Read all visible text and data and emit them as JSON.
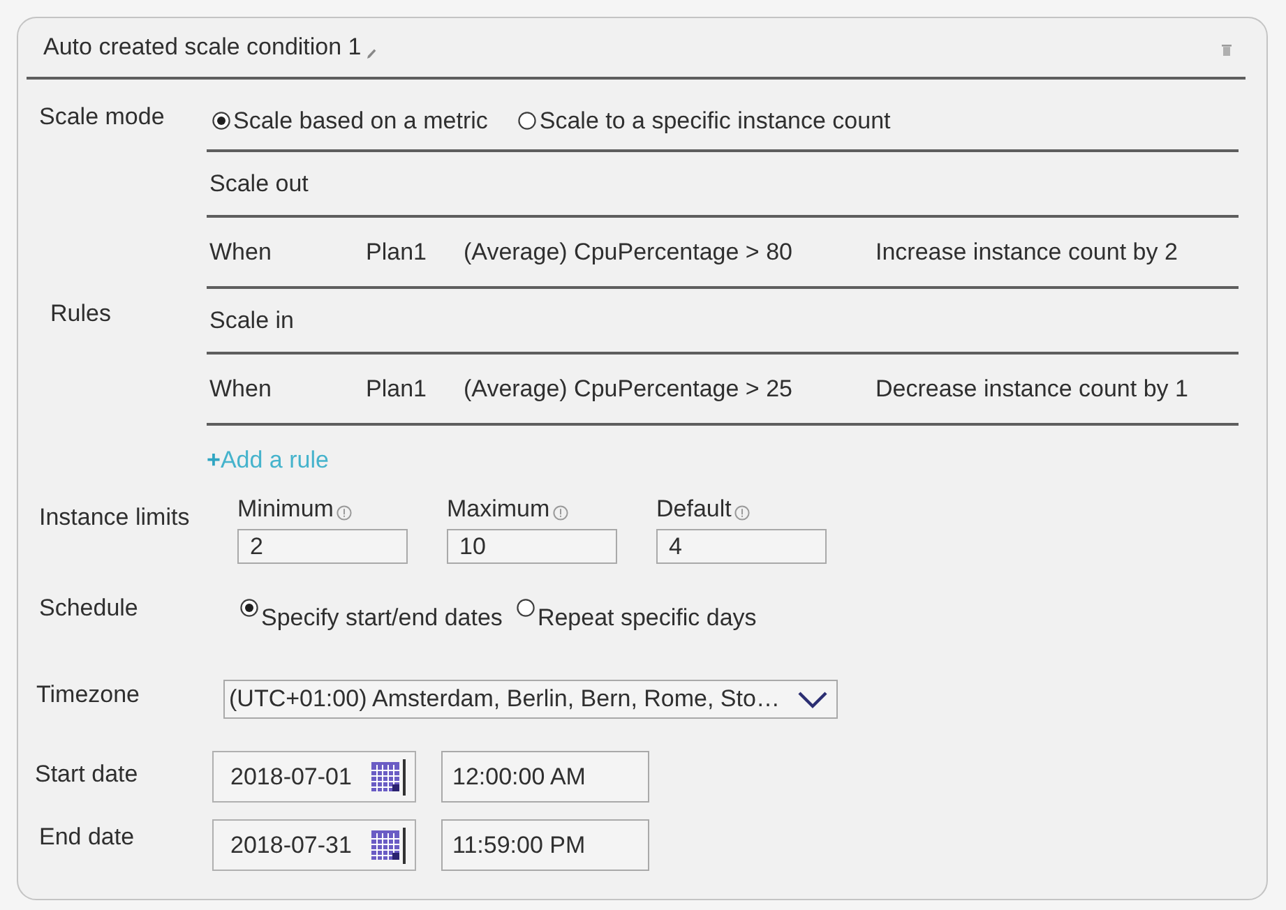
{
  "condition": {
    "title": "Auto created scale condition 1"
  },
  "scale_mode": {
    "label": "Scale mode",
    "options": [
      {
        "label": "Scale based on a metric",
        "selected": true
      },
      {
        "label": "Scale to a specific instance count",
        "selected": false
      }
    ]
  },
  "rules": {
    "label": "Rules",
    "groups": [
      {
        "title": "Scale out",
        "rules": [
          {
            "condition": "When",
            "resource": "Plan1",
            "metric": "(Average) CpuPercentage > 80",
            "action": "Increase instance count by 2"
          }
        ]
      },
      {
        "title": "Scale in",
        "rules": [
          {
            "condition": "When",
            "resource": "Plan1",
            "metric": "(Average) CpuPercentage > 25",
            "action": "Decrease instance count by 1"
          }
        ]
      }
    ],
    "add_link": "**+**Add a rule"
  },
  "instance_limits": {
    "label": "Instance limits",
    "fields": [
      {
        "label": "Minimum",
        "value": "2"
      },
      {
        "label": "Maximum",
        "value": "10"
      },
      {
        "label": "Default",
        "value": "4"
      }
    ]
  },
  "schedule": {
    "label": "Schedule",
    "options": [
      {
        "label": "Specify start/end dates",
        "selected": true
      },
      {
        "label": "Repeat specific days",
        "selected": false
      }
    ]
  },
  "timezone": {
    "label": "Timezone",
    "value": "(UTC+01:00) Amsterdam, Berlin, Bern, Rome, Sto…"
  },
  "dates": [
    {
      "label": "Start date",
      "date": "2018-07-01",
      "time": "12:00:00 AM"
    },
    {
      "label": "End date",
      "date": "2018-07-31",
      "time": "11:59:00 PM"
    }
  ]
}
